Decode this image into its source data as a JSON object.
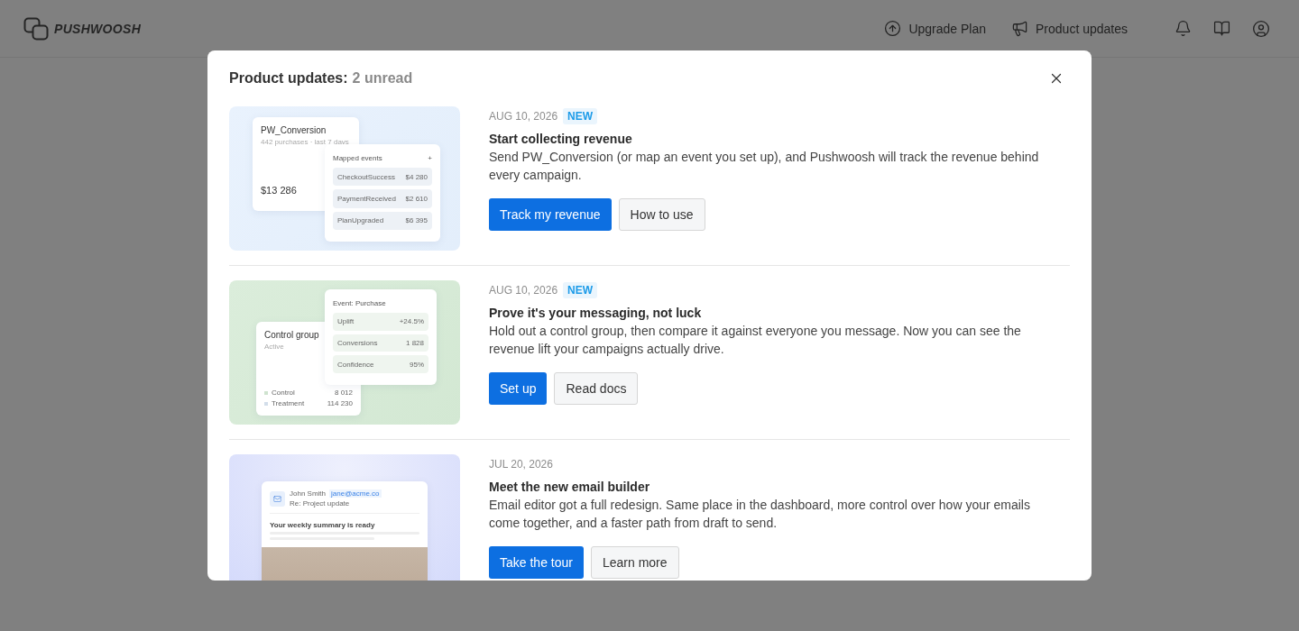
{
  "topbar": {
    "logo": "PUSHWOOSH",
    "actions": [
      {
        "kind": "upgrade",
        "label": "Upgrade Plan"
      },
      {
        "kind": "updates",
        "label": "Product updates"
      }
    ]
  },
  "modal": {
    "title": "Product updates:",
    "unread": "2 unread",
    "items": [
      {
        "date": "AUG 10, 2026",
        "badge": "NEW",
        "title": "Start collecting revenue",
        "body": "Send PW_Conversion (or map an event you set up), and Pushwoosh will track the revenue behind every campaign.",
        "primary": "Track my revenue",
        "secondary": "How to use",
        "illustration": {
          "kind": "revenue",
          "card_title": "PW_Conversion",
          "card_subtitle": "442 purchases · last 7 days",
          "amount": "$13 286",
          "panel_title": "Mapped events",
          "panel_action": "+",
          "rows": [
            {
              "name": "CheckoutSuccess",
              "value": "$4 280"
            },
            {
              "name": "PaymentReceived",
              "value": "$2 610"
            },
            {
              "name": "PlanUpgraded",
              "value": "$6 395"
            }
          ]
        }
      },
      {
        "date": "AUG 10, 2026",
        "badge": "NEW",
        "title": "Prove it's your messaging, not luck",
        "body": "Hold out a control group, then compare it against everyone you message. Now you can see the revenue lift your campaigns actually drive.",
        "primary": "Set up",
        "secondary": "Read docs",
        "illustration": {
          "kind": "control",
          "panel_title": "Event: Purchase",
          "rows": [
            {
              "name": "Uplift",
              "value": "+24.5%"
            },
            {
              "name": "Conversions",
              "value": "1 828"
            },
            {
              "name": "Confidence",
              "value": "95%"
            }
          ],
          "card_title": "Control group",
          "card_subtitle": "Active",
          "legend": [
            {
              "name": "Control",
              "value": "8 012",
              "color": "#cfe3cf"
            },
            {
              "name": "Treatment",
              "value": "114 230",
              "color": "#d3deea"
            }
          ]
        }
      },
      {
        "date": "JUL 20, 2026",
        "title": "Meet the new email builder",
        "body": "Email editor got a full redesign. Same place in the dashboard, more control over how your emails come together, and a faster path from draft to send.",
        "primary": "Take the tour",
        "secondary": "Learn more",
        "illustration": {
          "kind": "email",
          "sender": "John Smith",
          "address": "jane@acme.co",
          "subject": "Re: Project update",
          "heading": "Your weekly summary is ready"
        }
      }
    ]
  }
}
